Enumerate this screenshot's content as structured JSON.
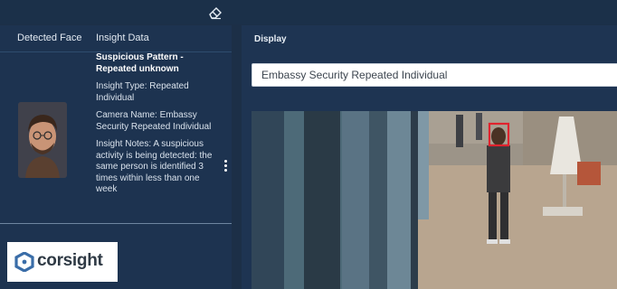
{
  "toolbar": {
    "clear_icon": "eraser-icon"
  },
  "table": {
    "headers": [
      "Detected Face",
      "Insight Data"
    ],
    "rows": [
      {
        "title": "Suspicious Pattern - Repeated unknown",
        "insight_type": "Insight Type: Repeated Individual",
        "camera_name": "Camera Name: Embassy Security Repeated Individual",
        "notes": "Insight Notes: A suspicious activity is being detected: the same person is identified 3 times within less than one week"
      }
    ]
  },
  "display": {
    "title": "Display",
    "camera_selected": "Embassy Security Repeated Individual"
  },
  "logo": {
    "text": "corsight",
    "icon": "corsight-logo-mark"
  },
  "colors": {
    "detection_box": "#e0232e",
    "panel": "#1d3350",
    "background": "#1c2f47"
  }
}
